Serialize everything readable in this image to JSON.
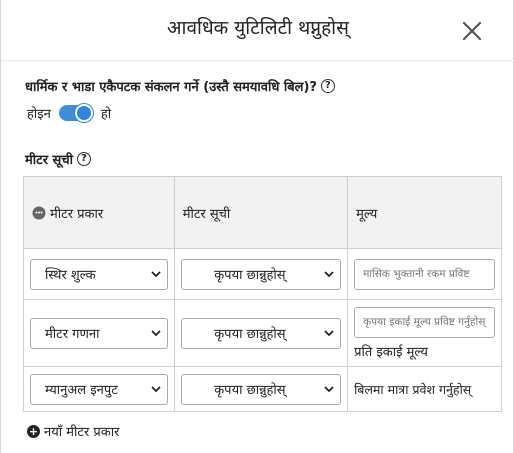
{
  "modal": {
    "title": "आवधिक युटिलिटी थप्नुहोस्",
    "close_icon": "close-icon"
  },
  "consolidation": {
    "question": "धार्मिक र भाडा एकैपटक संकलन गर्ने (उस्तै समयावधि बिल)?",
    "help_symbol": "?",
    "toggle_off_label": "होइन",
    "toggle_on_label": "हो",
    "toggle_value": true,
    "accent_color": "#2f84dc"
  },
  "meter_list": {
    "label": "मीटर सूची",
    "help_symbol": "?",
    "headers": {
      "meter_type": "मीटर प्रकार",
      "meter_list": "मीटर सूची",
      "value": "मूल्य"
    },
    "rows": [
      {
        "meter_type": "स्थिर शुल्क",
        "meter_select": "कृपया छान्नुहोस्",
        "value_placeholder": "मासिक भुक्तानी रकम प्रविष्ट",
        "value_note": ""
      },
      {
        "meter_type": "मीटर गणना",
        "meter_select": "कृपया छान्नुहोस्",
        "value_placeholder": "कृपया इकाई मूल्य प्रविष्ट गर्नुहोस्",
        "value_note": "प्रति इकाई मूल्य"
      },
      {
        "meter_type": "म्यानुअल इनपुट",
        "meter_select": "कृपया छान्नुहोस्",
        "value_placeholder": "",
        "value_note": "बिलमा मात्रा प्रवेश गर्नुहोस्"
      }
    ],
    "add_label": "नयाँ मीटर प्रकार"
  }
}
